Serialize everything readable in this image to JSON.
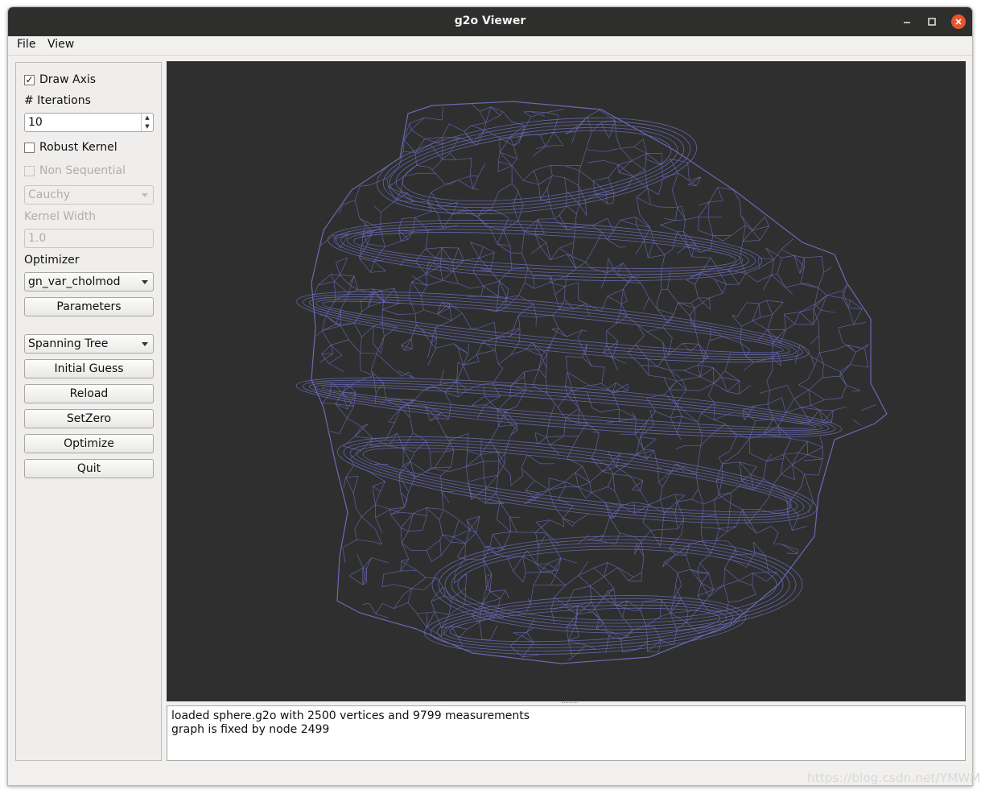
{
  "window": {
    "title": "g2o Viewer"
  },
  "menubar": {
    "file": "File",
    "view": "View"
  },
  "panel": {
    "draw_axis": {
      "label": "Draw Axis",
      "checked": true
    },
    "iterations_label": "# Iterations",
    "iterations_value": "10",
    "robust_kernel": {
      "label": "Robust Kernel",
      "checked": false
    },
    "non_sequential": {
      "label": "Non Sequential",
      "checked": false,
      "enabled": false
    },
    "kernel_select": "Cauchy",
    "kernel_width_label": "Kernel Width",
    "kernel_width_value": "1.0",
    "optimizer_label": "Optimizer",
    "optimizer_select": "gn_var_cholmod",
    "parameters_button": "Parameters",
    "guess_select": "Spanning Tree",
    "initial_guess_button": "Initial Guess",
    "reload_button": "Reload",
    "setzero_button": "SetZero",
    "optimize_button": "Optimize",
    "quit_button": "Quit"
  },
  "console": {
    "lines": [
      "loaded sphere.g2o with 2500 vertices and 9799 measurements",
      "graph is fixed by node 2499"
    ]
  },
  "colors": {
    "mesh": "#6a6ab8",
    "viewport_bg": "#2f2f2f",
    "titlebar_bg": "#2e2e2d",
    "close_button": "#e8552b"
  },
  "icons": {
    "minimize": "minimize-icon",
    "maximize": "maximize-icon",
    "close": "close-icon"
  },
  "watermark": "https://blog.csdn.net/YMWM_"
}
